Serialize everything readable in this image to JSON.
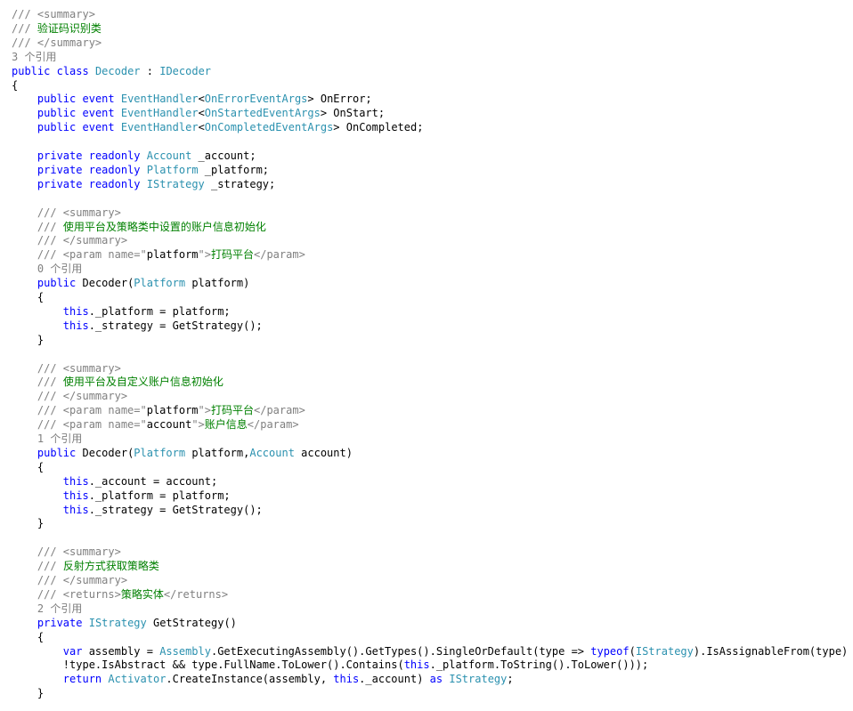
{
  "editor": {
    "colors": {
      "keyword": "#0000ff",
      "type": "#2b91af",
      "comment": "#008000",
      "doc_tag": "#808080",
      "codelens": "#808080",
      "text": "#000000",
      "background": "#ffffff"
    },
    "lines": [
      [
        {
          "t": "doc",
          "v": "/// "
        },
        {
          "t": "doc",
          "v": "<summary>"
        }
      ],
      [
        {
          "t": "doc",
          "v": "/// "
        },
        {
          "t": "com",
          "v": "验证码识别类"
        }
      ],
      [
        {
          "t": "doc",
          "v": "/// "
        },
        {
          "t": "doc",
          "v": "</summary>"
        }
      ],
      [
        {
          "t": "ref",
          "v": "3 个引用"
        }
      ],
      [
        {
          "t": "kw",
          "v": "public"
        },
        {
          "t": "plain",
          "v": " "
        },
        {
          "t": "kw",
          "v": "class"
        },
        {
          "t": "plain",
          "v": " "
        },
        {
          "t": "type",
          "v": "Decoder"
        },
        {
          "t": "plain",
          "v": " : "
        },
        {
          "t": "type",
          "v": "IDecoder"
        }
      ],
      [
        {
          "t": "plain",
          "v": "{"
        }
      ],
      [
        {
          "t": "plain",
          "v": "    "
        },
        {
          "t": "kw",
          "v": "public"
        },
        {
          "t": "plain",
          "v": " "
        },
        {
          "t": "kw",
          "v": "event"
        },
        {
          "t": "plain",
          "v": " "
        },
        {
          "t": "type",
          "v": "EventHandler"
        },
        {
          "t": "plain",
          "v": "<"
        },
        {
          "t": "type",
          "v": "OnErrorEventArgs"
        },
        {
          "t": "plain",
          "v": "> OnError;"
        }
      ],
      [
        {
          "t": "plain",
          "v": "    "
        },
        {
          "t": "kw",
          "v": "public"
        },
        {
          "t": "plain",
          "v": " "
        },
        {
          "t": "kw",
          "v": "event"
        },
        {
          "t": "plain",
          "v": " "
        },
        {
          "t": "type",
          "v": "EventHandler"
        },
        {
          "t": "plain",
          "v": "<"
        },
        {
          "t": "type",
          "v": "OnStartedEventArgs"
        },
        {
          "t": "plain",
          "v": "> OnStart;"
        }
      ],
      [
        {
          "t": "plain",
          "v": "    "
        },
        {
          "t": "kw",
          "v": "public"
        },
        {
          "t": "plain",
          "v": " "
        },
        {
          "t": "kw",
          "v": "event"
        },
        {
          "t": "plain",
          "v": " "
        },
        {
          "t": "type",
          "v": "EventHandler"
        },
        {
          "t": "plain",
          "v": "<"
        },
        {
          "t": "type",
          "v": "OnCompletedEventArgs"
        },
        {
          "t": "plain",
          "v": "> OnCompleted;"
        }
      ],
      [],
      [
        {
          "t": "plain",
          "v": "    "
        },
        {
          "t": "kw",
          "v": "private"
        },
        {
          "t": "plain",
          "v": " "
        },
        {
          "t": "kw",
          "v": "readonly"
        },
        {
          "t": "plain",
          "v": " "
        },
        {
          "t": "type",
          "v": "Account"
        },
        {
          "t": "plain",
          "v": " _account;"
        }
      ],
      [
        {
          "t": "plain",
          "v": "    "
        },
        {
          "t": "kw",
          "v": "private"
        },
        {
          "t": "plain",
          "v": " "
        },
        {
          "t": "kw",
          "v": "readonly"
        },
        {
          "t": "plain",
          "v": " "
        },
        {
          "t": "type",
          "v": "Platform"
        },
        {
          "t": "plain",
          "v": " _platform;"
        }
      ],
      [
        {
          "t": "plain",
          "v": "    "
        },
        {
          "t": "kw",
          "v": "private"
        },
        {
          "t": "plain",
          "v": " "
        },
        {
          "t": "kw",
          "v": "readonly"
        },
        {
          "t": "plain",
          "v": " "
        },
        {
          "t": "type",
          "v": "IStrategy"
        },
        {
          "t": "plain",
          "v": " _strategy;"
        }
      ],
      [],
      [
        {
          "t": "plain",
          "v": "    "
        },
        {
          "t": "doc",
          "v": "/// <summary>"
        }
      ],
      [
        {
          "t": "plain",
          "v": "    "
        },
        {
          "t": "doc",
          "v": "/// "
        },
        {
          "t": "com",
          "v": "使用平台及策略类中设置的账户信息初始化"
        }
      ],
      [
        {
          "t": "plain",
          "v": "    "
        },
        {
          "t": "doc",
          "v": "/// </summary>"
        }
      ],
      [
        {
          "t": "plain",
          "v": "    "
        },
        {
          "t": "doc",
          "v": "/// <param name=\""
        },
        {
          "t": "plain",
          "v": "platform"
        },
        {
          "t": "doc",
          "v": "\">"
        },
        {
          "t": "com",
          "v": "打码平台"
        },
        {
          "t": "doc",
          "v": "</param>"
        }
      ],
      [
        {
          "t": "plain",
          "v": "    "
        },
        {
          "t": "ref",
          "v": "0 个引用"
        }
      ],
      [
        {
          "t": "plain",
          "v": "    "
        },
        {
          "t": "kw",
          "v": "public"
        },
        {
          "t": "plain",
          "v": " Decoder("
        },
        {
          "t": "type",
          "v": "Platform"
        },
        {
          "t": "plain",
          "v": " platform)"
        }
      ],
      [
        {
          "t": "plain",
          "v": "    {"
        }
      ],
      [
        {
          "t": "plain",
          "v": "        "
        },
        {
          "t": "kw",
          "v": "this"
        },
        {
          "t": "plain",
          "v": "._platform = platform;"
        }
      ],
      [
        {
          "t": "plain",
          "v": "        "
        },
        {
          "t": "kw",
          "v": "this"
        },
        {
          "t": "plain",
          "v": "._strategy = GetStrategy();"
        }
      ],
      [
        {
          "t": "plain",
          "v": "    }"
        }
      ],
      [],
      [
        {
          "t": "plain",
          "v": "    "
        },
        {
          "t": "doc",
          "v": "/// <summary>"
        }
      ],
      [
        {
          "t": "plain",
          "v": "    "
        },
        {
          "t": "doc",
          "v": "/// "
        },
        {
          "t": "com",
          "v": "使用平台及自定义账户信息初始化"
        }
      ],
      [
        {
          "t": "plain",
          "v": "    "
        },
        {
          "t": "doc",
          "v": "/// </summary>"
        }
      ],
      [
        {
          "t": "plain",
          "v": "    "
        },
        {
          "t": "doc",
          "v": "/// <param name=\""
        },
        {
          "t": "plain",
          "v": "platform"
        },
        {
          "t": "doc",
          "v": "\">"
        },
        {
          "t": "com",
          "v": "打码平台"
        },
        {
          "t": "doc",
          "v": "</param>"
        }
      ],
      [
        {
          "t": "plain",
          "v": "    "
        },
        {
          "t": "doc",
          "v": "/// <param name=\""
        },
        {
          "t": "plain",
          "v": "account"
        },
        {
          "t": "doc",
          "v": "\">"
        },
        {
          "t": "com",
          "v": "账户信息"
        },
        {
          "t": "doc",
          "v": "</param>"
        }
      ],
      [
        {
          "t": "plain",
          "v": "    "
        },
        {
          "t": "ref",
          "v": "1 个引用"
        }
      ],
      [
        {
          "t": "plain",
          "v": "    "
        },
        {
          "t": "kw",
          "v": "public"
        },
        {
          "t": "plain",
          "v": " Decoder("
        },
        {
          "t": "type",
          "v": "Platform"
        },
        {
          "t": "plain",
          "v": " platform,"
        },
        {
          "t": "type",
          "v": "Account"
        },
        {
          "t": "plain",
          "v": " account)"
        }
      ],
      [
        {
          "t": "plain",
          "v": "    {"
        }
      ],
      [
        {
          "t": "plain",
          "v": "        "
        },
        {
          "t": "kw",
          "v": "this"
        },
        {
          "t": "plain",
          "v": "._account = account;"
        }
      ],
      [
        {
          "t": "plain",
          "v": "        "
        },
        {
          "t": "kw",
          "v": "this"
        },
        {
          "t": "plain",
          "v": "._platform = platform;"
        }
      ],
      [
        {
          "t": "plain",
          "v": "        "
        },
        {
          "t": "kw",
          "v": "this"
        },
        {
          "t": "plain",
          "v": "._strategy = GetStrategy();"
        }
      ],
      [
        {
          "t": "plain",
          "v": "    }"
        }
      ],
      [],
      [
        {
          "t": "plain",
          "v": "    "
        },
        {
          "t": "doc",
          "v": "/// <summary>"
        }
      ],
      [
        {
          "t": "plain",
          "v": "    "
        },
        {
          "t": "doc",
          "v": "/// "
        },
        {
          "t": "com",
          "v": "反射方式获取策略类"
        }
      ],
      [
        {
          "t": "plain",
          "v": "    "
        },
        {
          "t": "doc",
          "v": "/// </summary>"
        }
      ],
      [
        {
          "t": "plain",
          "v": "    "
        },
        {
          "t": "doc",
          "v": "/// <returns>"
        },
        {
          "t": "com",
          "v": "策略实体"
        },
        {
          "t": "doc",
          "v": "</returns>"
        }
      ],
      [
        {
          "t": "plain",
          "v": "    "
        },
        {
          "t": "ref",
          "v": "2 个引用"
        }
      ],
      [
        {
          "t": "plain",
          "v": "    "
        },
        {
          "t": "kw",
          "v": "private"
        },
        {
          "t": "plain",
          "v": " "
        },
        {
          "t": "type",
          "v": "IStrategy"
        },
        {
          "t": "plain",
          "v": " GetStrategy()"
        }
      ],
      [
        {
          "t": "plain",
          "v": "    {"
        }
      ],
      [
        {
          "t": "plain",
          "v": "        "
        },
        {
          "t": "kw",
          "v": "var"
        },
        {
          "t": "plain",
          "v": " assembly = "
        },
        {
          "t": "type",
          "v": "Assembly"
        },
        {
          "t": "plain",
          "v": ".GetExecutingAssembly().GetTypes().SingleOrDefault(type => "
        },
        {
          "t": "kw",
          "v": "typeof"
        },
        {
          "t": "plain",
          "v": "("
        },
        {
          "t": "type",
          "v": "IStrategy"
        },
        {
          "t": "plain",
          "v": ").IsAssignableFrom(type) &&"
        }
      ],
      [
        {
          "t": "plain",
          "v": "        !type.IsAbstract && type.FullName.ToLower().Contains("
        },
        {
          "t": "kw",
          "v": "this"
        },
        {
          "t": "plain",
          "v": "._platform.ToString().ToLower()));"
        }
      ],
      [
        {
          "t": "plain",
          "v": "        "
        },
        {
          "t": "kw",
          "v": "return"
        },
        {
          "t": "plain",
          "v": " "
        },
        {
          "t": "type",
          "v": "Activator"
        },
        {
          "t": "plain",
          "v": ".CreateInstance(assembly, "
        },
        {
          "t": "kw",
          "v": "this"
        },
        {
          "t": "plain",
          "v": "._account) "
        },
        {
          "t": "kw",
          "v": "as"
        },
        {
          "t": "plain",
          "v": " "
        },
        {
          "t": "type",
          "v": "IStrategy"
        },
        {
          "t": "plain",
          "v": ";"
        }
      ],
      [
        {
          "t": "plain",
          "v": "    }"
        }
      ]
    ]
  }
}
